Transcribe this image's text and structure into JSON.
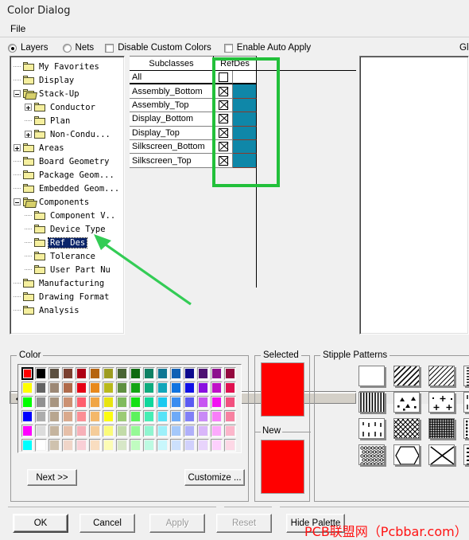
{
  "window": {
    "title": "Color Dialog"
  },
  "menubar": {
    "items": [
      {
        "label": "File"
      }
    ]
  },
  "options": {
    "layers_label": "Layers",
    "nets_label": "Nets",
    "disable_custom_colors_label": "Disable Custom Colors",
    "enable_auto_apply_label": "Enable Auto Apply",
    "clipped_right_label": "Gl",
    "layers_selected": true,
    "nets_selected": false,
    "disable_custom_colors_checked": false,
    "enable_auto_apply_checked": false
  },
  "tree": {
    "items": [
      {
        "label": "My Favorites",
        "depth": 1,
        "twist": "none",
        "open": false
      },
      {
        "label": "Display",
        "depth": 1,
        "twist": "none",
        "open": false
      },
      {
        "label": "Stack-Up",
        "depth": 1,
        "twist": "minus",
        "open": true
      },
      {
        "label": "Conductor",
        "depth": 2,
        "twist": "plus",
        "open": false
      },
      {
        "label": "Plan",
        "depth": 2,
        "twist": "none",
        "open": false
      },
      {
        "label": "Non-Condu...",
        "depth": 2,
        "twist": "plus",
        "open": false
      },
      {
        "label": "Areas",
        "depth": 1,
        "twist": "plus",
        "open": false
      },
      {
        "label": "Board Geometry",
        "depth": 1,
        "twist": "none",
        "open": false
      },
      {
        "label": "Package Geom...",
        "depth": 1,
        "twist": "none",
        "open": false
      },
      {
        "label": "Embedded Geom...",
        "depth": 1,
        "twist": "none",
        "open": false
      },
      {
        "label": "Components",
        "depth": 1,
        "twist": "minus",
        "open": true
      },
      {
        "label": "Component V..",
        "depth": 2,
        "twist": "none",
        "open": false
      },
      {
        "label": "Device Type",
        "depth": 2,
        "twist": "none",
        "open": false
      },
      {
        "label": "Ref Des",
        "depth": 2,
        "twist": "none",
        "open": false,
        "selected": true
      },
      {
        "label": "Tolerance",
        "depth": 2,
        "twist": "none",
        "open": false
      },
      {
        "label": "User Part Nu",
        "depth": 2,
        "twist": "none",
        "open": false
      },
      {
        "label": "Manufacturing",
        "depth": 1,
        "twist": "none",
        "open": false
      },
      {
        "label": "Drawing Format",
        "depth": 1,
        "twist": "none",
        "open": false
      },
      {
        "label": "Analysis",
        "depth": 1,
        "twist": "none",
        "open": false
      }
    ]
  },
  "table": {
    "headers": [
      "Subclasses",
      "RefDes"
    ],
    "rows": [
      {
        "name": "All",
        "checked": false,
        "color": ""
      },
      {
        "name": "Assembly_Bottom",
        "checked": true,
        "color": "#0f87a8"
      },
      {
        "name": "Assembly_Top",
        "checked": true,
        "color": "#0f87a8"
      },
      {
        "name": "Display_Bottom",
        "checked": true,
        "color": "#0f87a8"
      },
      {
        "name": "Display_Top",
        "checked": true,
        "color": "#0f87a8"
      },
      {
        "name": "Silkscreen_Bottom",
        "checked": true,
        "color": "#0f87a8"
      },
      {
        "name": "Silkscreen_Top",
        "checked": true,
        "color": "#0f87a8"
      }
    ]
  },
  "annotation": {
    "highlight_color": "#22c03a",
    "arrow_color": "#33cc55",
    "arrow_target": "refdes-column",
    "arrow_source": "tree-item-ref-des"
  },
  "color_group": {
    "caption": "Color",
    "next_label": "Next >>",
    "customize_label": "Customize ...",
    "selected_index": 0,
    "palette": [
      "#ff0000",
      "#000000",
      "#5c5040",
      "#7a4030",
      "#ae0014",
      "#b56410",
      "#9d9c21",
      "#4a6634",
      "#0f6b10",
      "#0f8063",
      "#0f7794",
      "#1061b5",
      "#0c0a8e",
      "#4e1173",
      "#8d108e",
      "#95093f",
      "#ffff00",
      "#636363",
      "#9c8875",
      "#b06b4b",
      "#e60014",
      "#e8891c",
      "#b9b91c",
      "#5f9040",
      "#14a414",
      "#0fab7d",
      "#11a6ba",
      "#1074e0",
      "#1011e6",
      "#8a11e0",
      "#c010c7",
      "#e0104f",
      "#00ff00",
      "#919191",
      "#a89580",
      "#cc9172",
      "#ff5f6e",
      "#f0a545",
      "#e7e410",
      "#80bb5c",
      "#14e014",
      "#10d79c",
      "#1ac9ef",
      "#3a8df0",
      "#5b5bf2",
      "#c755f2",
      "#f211f2",
      "#f2507f",
      "#0000ff",
      "#adadad",
      "#b8a68f",
      "#d9a98c",
      "#fc8e95",
      "#f4b86a",
      "#fcfc10",
      "#9ccb75",
      "#5cf25c",
      "#46eeb4",
      "#58e3f7",
      "#6eaaf7",
      "#8080f7",
      "#c98af7",
      "#f87ef8",
      "#f881a1",
      "#ff00ff",
      "#dcdcdc",
      "#c5b49e",
      "#e6bfa8",
      "#f7b0b8",
      "#f5cc99",
      "#fbfb79",
      "#c2dba8",
      "#96f996",
      "#90f5d0",
      "#9df0fa",
      "#a4c8fa",
      "#b0b0fa",
      "#d9b6fa",
      "#fcaafc",
      "#fcb6cb",
      "#00ffff",
      "#ffffff",
      "#cfc2ae",
      "#f0d5c8",
      "#f9cfd6",
      "#f9ddc0",
      "#fcfcb5",
      "#d7e7c7",
      "#c0fcc0",
      "#bdfae2",
      "#c8f7fc",
      "#cce0fc",
      "#d1d1fc",
      "#e8d4fc",
      "#fdd0fd",
      "#fdd8e6"
    ]
  },
  "selected_group": {
    "caption": "Selected",
    "new_caption": "New",
    "selected_color": "#ff0000",
    "new_color": "#ff0000"
  },
  "stipple_group": {
    "caption": "Stipple Patterns",
    "patterns": [
      "solid-blank",
      "diagonal-lines-right",
      "diagonal-lines-thin",
      "dashed-vertical-ticks",
      "vertical-lines",
      "triangles-dots",
      "plus-signs-dots",
      "vertical-dashes-sparse",
      "vertical-dots-dashes",
      "cross-hatch-diamond",
      "dense-grid",
      "dotted-grid",
      "small-circles",
      "hexagon-outline",
      "large-x-cross",
      "dots-and-dashes"
    ]
  },
  "buttons": {
    "ok": "OK",
    "cancel": "Cancel",
    "apply": "Apply",
    "reset": "Reset",
    "hide_palette": "Hide Palette",
    "apply_enabled": false,
    "reset_enabled": false
  },
  "watermark": {
    "text": "PCB联盟网（Pcbbar.com）",
    "color": "#ff1212"
  }
}
